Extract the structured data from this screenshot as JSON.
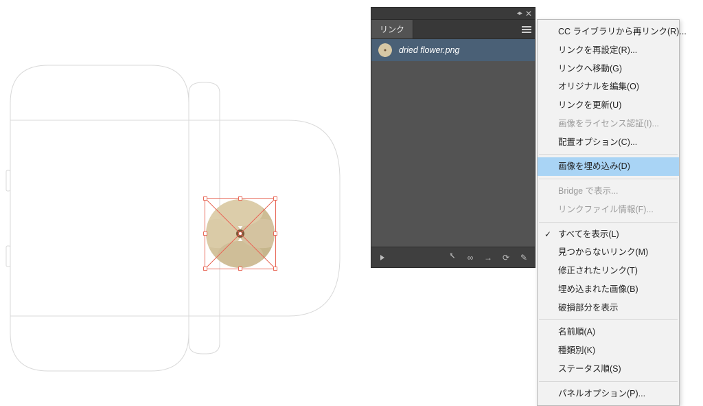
{
  "panel": {
    "title": "リンク",
    "item": {
      "name": "dried flower.png"
    },
    "footer_icons": [
      "disclosure",
      "relink",
      "link",
      "goto",
      "update",
      "edit"
    ]
  },
  "menu": {
    "groups": [
      [
        {
          "key": "relink_cc",
          "label": "CC ライブラリから再リンク(R)...",
          "state": "normal"
        },
        {
          "key": "relink",
          "label": "リンクを再設定(R)...",
          "state": "normal"
        },
        {
          "key": "goto",
          "label": "リンクへ移動(G)",
          "state": "normal"
        },
        {
          "key": "edit_original",
          "label": "オリジナルを編集(O)",
          "state": "normal"
        },
        {
          "key": "update",
          "label": "リンクを更新(U)",
          "state": "normal"
        },
        {
          "key": "license",
          "label": "画像をライセンス認証(I)...",
          "state": "disabled"
        },
        {
          "key": "place_options",
          "label": "配置オプション(C)...",
          "state": "normal"
        }
      ],
      [
        {
          "key": "embed",
          "label": "画像を埋め込み(D)",
          "state": "highlight"
        }
      ],
      [
        {
          "key": "bridge",
          "label": "Bridge で表示...",
          "state": "disabled"
        },
        {
          "key": "file_info",
          "label": "リンクファイル情報(F)...",
          "state": "disabled"
        }
      ],
      [
        {
          "key": "show_all",
          "label": "すべてを表示(L)",
          "state": "checked"
        },
        {
          "key": "missing",
          "label": "見つからないリンク(M)",
          "state": "normal"
        },
        {
          "key": "modified",
          "label": "修正されたリンク(T)",
          "state": "normal"
        },
        {
          "key": "embedded",
          "label": "埋め込まれた画像(B)",
          "state": "normal"
        },
        {
          "key": "damaged",
          "label": "破損部分を表示",
          "state": "normal"
        }
      ],
      [
        {
          "key": "sort_name",
          "label": "名前順(A)",
          "state": "normal"
        },
        {
          "key": "sort_kind",
          "label": "種類別(K)",
          "state": "normal"
        },
        {
          "key": "sort_status",
          "label": "ステータス順(S)",
          "state": "normal"
        }
      ],
      [
        {
          "key": "panel_options",
          "label": "パネルオプション(P)...",
          "state": "normal"
        }
      ]
    ]
  },
  "colors": {
    "panel_bg": "#535353",
    "selected_row": "#4a6076",
    "menu_highlight": "#a9d4f5",
    "selection_handle": "#e86a5a"
  }
}
